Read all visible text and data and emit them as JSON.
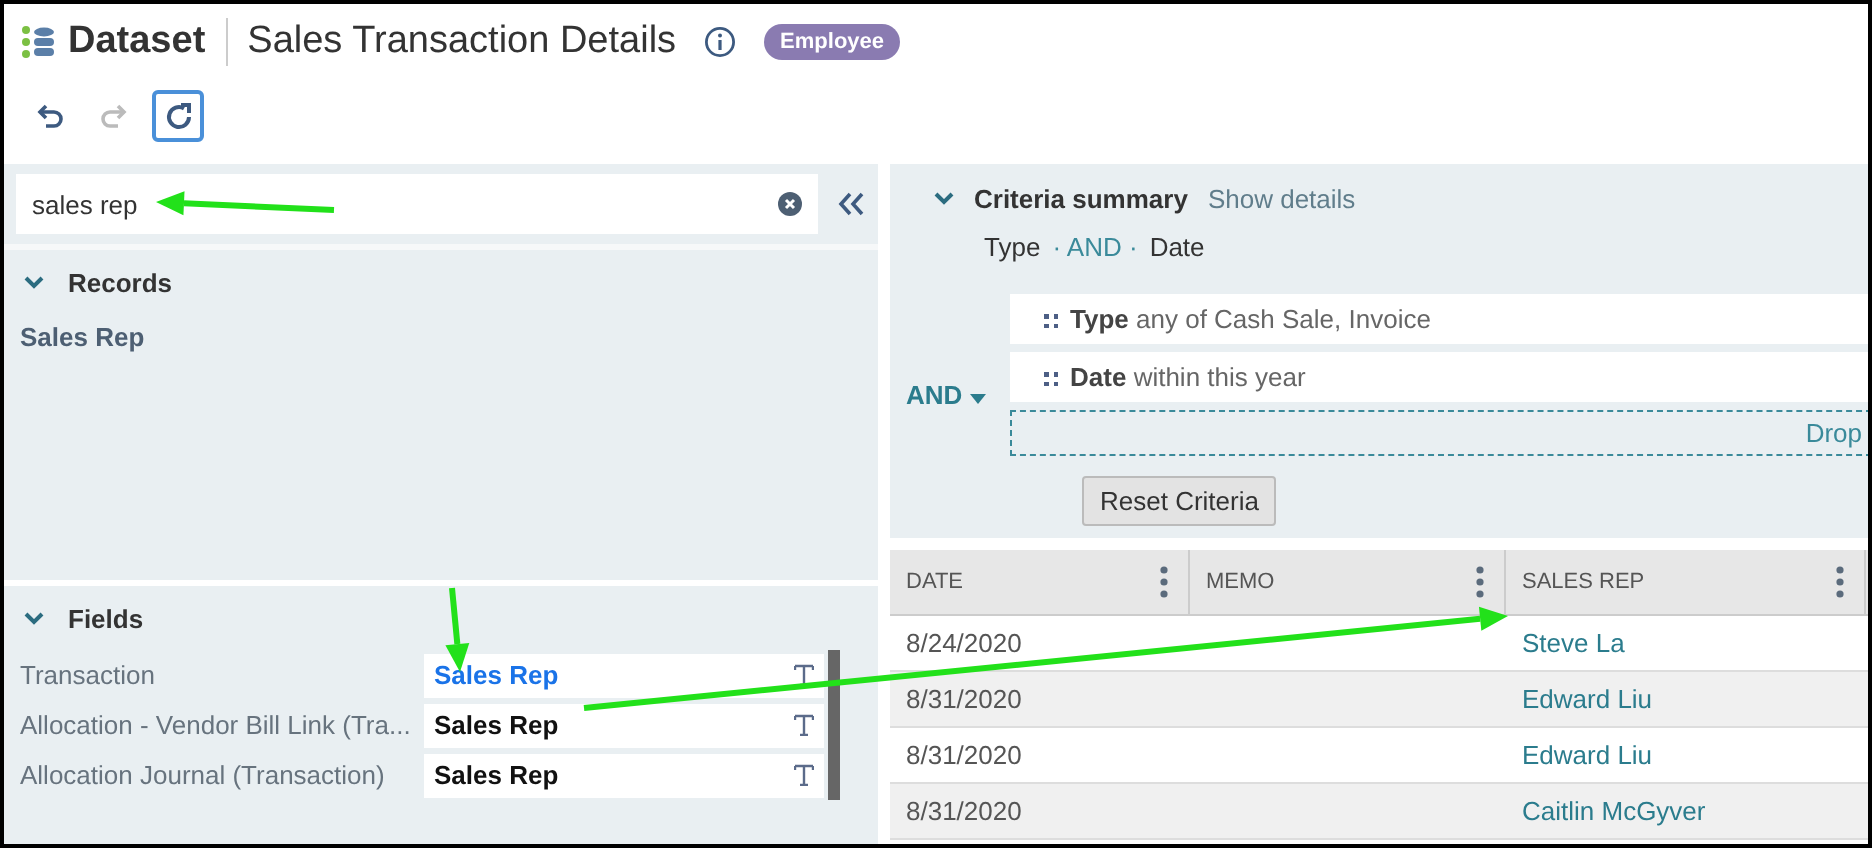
{
  "header": {
    "app": "Dataset",
    "title": "Sales Transaction Details",
    "badge": "Employee"
  },
  "toolbar": [
    {
      "kind": "undo",
      "disabled": false,
      "focused": false
    },
    {
      "kind": "redo",
      "disabled": true,
      "focused": false
    },
    {
      "kind": "refresh",
      "disabled": false,
      "focused": true
    }
  ],
  "search": {
    "value": "sales rep"
  },
  "records": {
    "title": "Records",
    "expanded": true,
    "items": [
      "Sales Rep"
    ]
  },
  "fields": {
    "title": "Fields",
    "expanded": true,
    "rows": [
      {
        "label": "Transaction",
        "value": "Sales Rep",
        "selected": true
      },
      {
        "label": "Allocation - Vendor Bill Link (Tra...",
        "value": "Sales Rep",
        "selected": false
      },
      {
        "label": "Allocation Journal (Transaction)",
        "value": "Sales Rep",
        "selected": false
      }
    ]
  },
  "criteria": {
    "title": "Criteria summary",
    "link": "Show details",
    "expanded": true,
    "summary_left": "Type",
    "summary_operator": "· AND ·",
    "summary_right": "Date",
    "operator": "AND",
    "conditions": [
      {
        "field": "Type",
        "text": "any of Cash Sale, Invoice"
      },
      {
        "field": "Date",
        "text": "within this year"
      }
    ],
    "drop": "Drop",
    "reset": "Reset Criteria"
  },
  "table": {
    "columns": [
      "DATE",
      "MEMO",
      "SALES REP"
    ],
    "rows": [
      {
        "date": "8/24/2020",
        "sales_rep": "Steve La"
      },
      {
        "date": "8/31/2020",
        "sales_rep": "Edward Liu"
      },
      {
        "date": "8/31/2020",
        "sales_rep": "Edward Liu"
      },
      {
        "date": "8/31/2020",
        "sales_rep": "Caitlin McGyver"
      }
    ]
  }
}
